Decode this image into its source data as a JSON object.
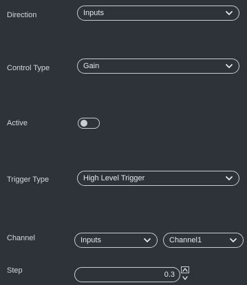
{
  "fields": {
    "direction": {
      "label": "Direction",
      "value": "Inputs"
    },
    "control_type": {
      "label": "Control Type",
      "value": "Gain"
    },
    "active": {
      "label": "Active",
      "enabled": false
    },
    "trigger_type": {
      "label": "Trigger Type",
      "value": "High Level Trigger"
    },
    "channel": {
      "label": "Channel",
      "source": "Inputs",
      "channel": "Channel1"
    },
    "step": {
      "label": "Step",
      "value": "0.3"
    }
  },
  "icons": {
    "dropdown": "chevron-down-icon",
    "increment": "spin-up-icon",
    "decrement": "spin-down-icon"
  },
  "colors": {
    "background": "#2d3339",
    "border": "#c9ced3",
    "text": "#d8dde2"
  }
}
